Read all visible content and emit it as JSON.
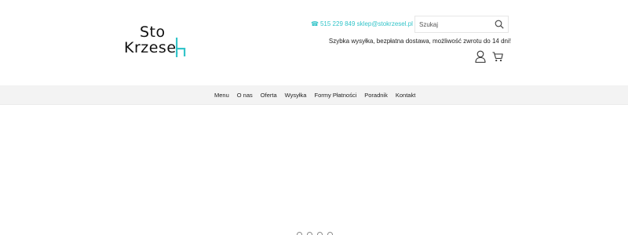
{
  "logo": {
    "line1": "Sto",
    "line2": "Krzese"
  },
  "contact": {
    "phone_icon": "☎",
    "text": "515 229 849 sklep@stokrzesel.pl"
  },
  "search": {
    "placeholder": "Szukaj"
  },
  "tagline": "Szybka wysyłka, bezpłatna dostawa, możliwość zwrotu do 14 dni!",
  "icons": {
    "user": "user-icon",
    "cart": "cart-icon",
    "search": "search-icon"
  },
  "nav": {
    "items": [
      {
        "label": "Menu"
      },
      {
        "label": "O nas"
      },
      {
        "label": "Oferta"
      },
      {
        "label": "Wysyłka"
      },
      {
        "label": "Formy Płatności"
      },
      {
        "label": "Poradnik"
      },
      {
        "label": "Kontakt"
      }
    ]
  },
  "slider": {
    "dot_count": 4
  },
  "colors": {
    "accent": "#33c4c9",
    "nav_bg": "#f3f3f3"
  }
}
